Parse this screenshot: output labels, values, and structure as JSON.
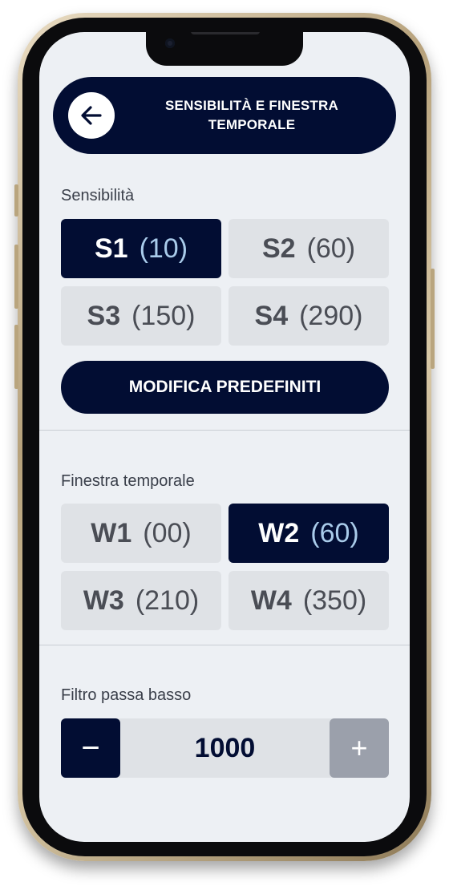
{
  "header": {
    "title": "SENSIBILITÀ E FINESTRA\nTEMPORALE"
  },
  "sensitivity": {
    "label": "Sensibilità",
    "options": [
      {
        "code": "S1",
        "value": "(10)",
        "selected": true
      },
      {
        "code": "S2",
        "value": "(60)",
        "selected": false
      },
      {
        "code": "S3",
        "value": "(150)",
        "selected": false
      },
      {
        "code": "S4",
        "value": "(290)",
        "selected": false
      }
    ],
    "edit_button": "MODIFICA PREDEFINITI"
  },
  "window": {
    "label": "Finestra temporale",
    "options": [
      {
        "code": "W1",
        "value": "(00)",
        "selected": false
      },
      {
        "code": "W2",
        "value": "(60)",
        "selected": true
      },
      {
        "code": "W3",
        "value": "(210)",
        "selected": false
      },
      {
        "code": "W4",
        "value": "(350)",
        "selected": false
      }
    ]
  },
  "lowpass": {
    "label": "Filtro passa basso",
    "value": "1000",
    "minus": "−",
    "plus": "+"
  },
  "colors": {
    "primary": "#020d33",
    "option_bg": "#dfe2e6",
    "selected_value": "#a9cbea",
    "screen_bg": "#edf0f4",
    "plus_disabled": "#9ba0ab"
  }
}
